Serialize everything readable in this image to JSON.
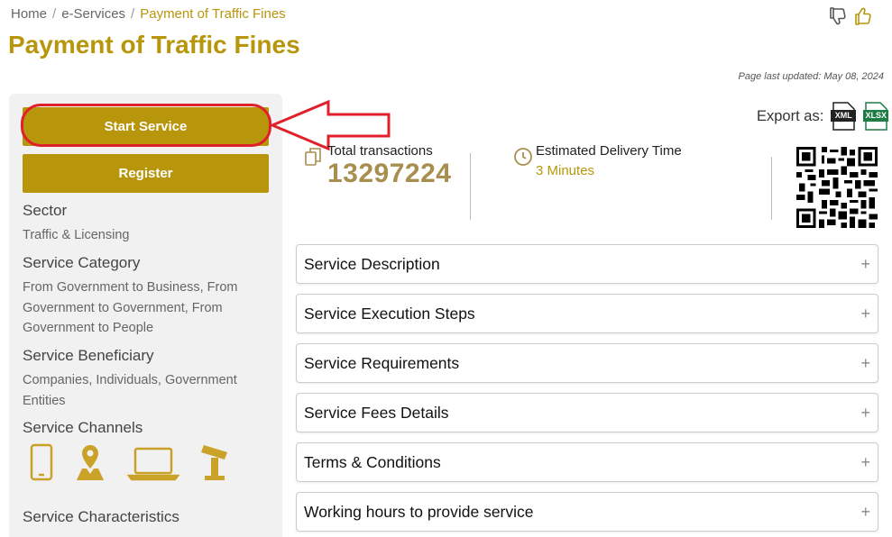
{
  "breadcrumb": {
    "home": "Home",
    "eservices": "e-Services",
    "current": "Payment of Traffic Fines",
    "separator": "/"
  },
  "feedback": {
    "dislike_icon": "thumbs-down-icon",
    "like_icon": "thumbs-up-icon"
  },
  "page": {
    "title": "Payment of Traffic Fines",
    "last_updated": "Page last updated: May 08, 2024"
  },
  "sidebar": {
    "start_service_label": "Start Service",
    "register_label": "Register",
    "sector": {
      "heading": "Sector",
      "value": "Traffic & Licensing"
    },
    "category": {
      "heading": "Service Category",
      "value": "From Government to Business, From Government to Government, From Government to People"
    },
    "beneficiary": {
      "heading": "Service Beneficiary",
      "value": "Companies, Individuals, Government Entities"
    },
    "channels": {
      "heading": "Service Channels",
      "icons": [
        "mobile-icon",
        "location-map-icon",
        "laptop-icon",
        "kiosk-icon"
      ]
    },
    "characteristics": {
      "heading": "Service Characteristics"
    }
  },
  "export": {
    "label": "Export as:",
    "xml": "XML",
    "xlsx": "XLSX"
  },
  "stats": {
    "transactions_label": "Total transactions",
    "transactions_value": "13297224",
    "delivery_label": "Estimated Delivery Time",
    "delivery_value": "3 Minutes"
  },
  "accordion": [
    {
      "title": "Service Description"
    },
    {
      "title": "Service Execution Steps"
    },
    {
      "title": "Service Requirements"
    },
    {
      "title": "Service Fees Details"
    },
    {
      "title": "Terms & Conditions"
    },
    {
      "title": "Working hours to provide service"
    }
  ],
  "accordion_expand_symbol": "+",
  "colors": {
    "gold": "#b8960c",
    "highlight_red": "#e0202a",
    "sidebar_bg": "#f1f1f1"
  }
}
